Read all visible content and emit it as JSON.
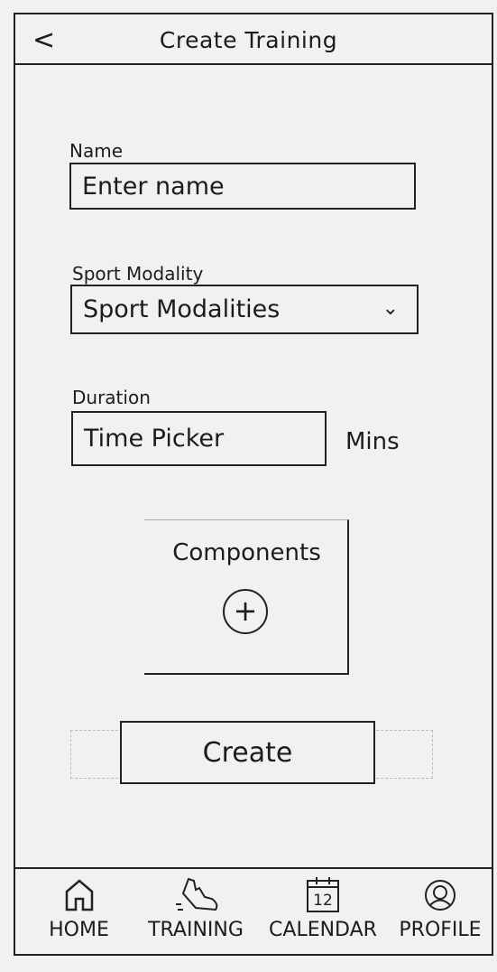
{
  "header": {
    "back_icon": "chevron-left-icon",
    "back_glyph": "<",
    "title": "Create Training"
  },
  "form": {
    "name": {
      "label": "Name",
      "placeholder": "Enter name"
    },
    "sport": {
      "label": "Sport Modality",
      "value": "Sport Modalities",
      "chevron": "⌄"
    },
    "duration": {
      "label": "Duration",
      "value": "Time Picker",
      "unit": "Mins"
    },
    "components": {
      "label": "Components",
      "add_glyph": "+"
    },
    "create_label": "Create"
  },
  "nav": {
    "items": [
      {
        "label": "HOME",
        "icon": "home-icon"
      },
      {
        "label": "TRAINING",
        "icon": "shoe-icon"
      },
      {
        "label": "CALENDAR",
        "icon": "calendar-icon",
        "icon_text": "12"
      },
      {
        "label": "PROFILE",
        "icon": "profile-icon"
      }
    ]
  }
}
